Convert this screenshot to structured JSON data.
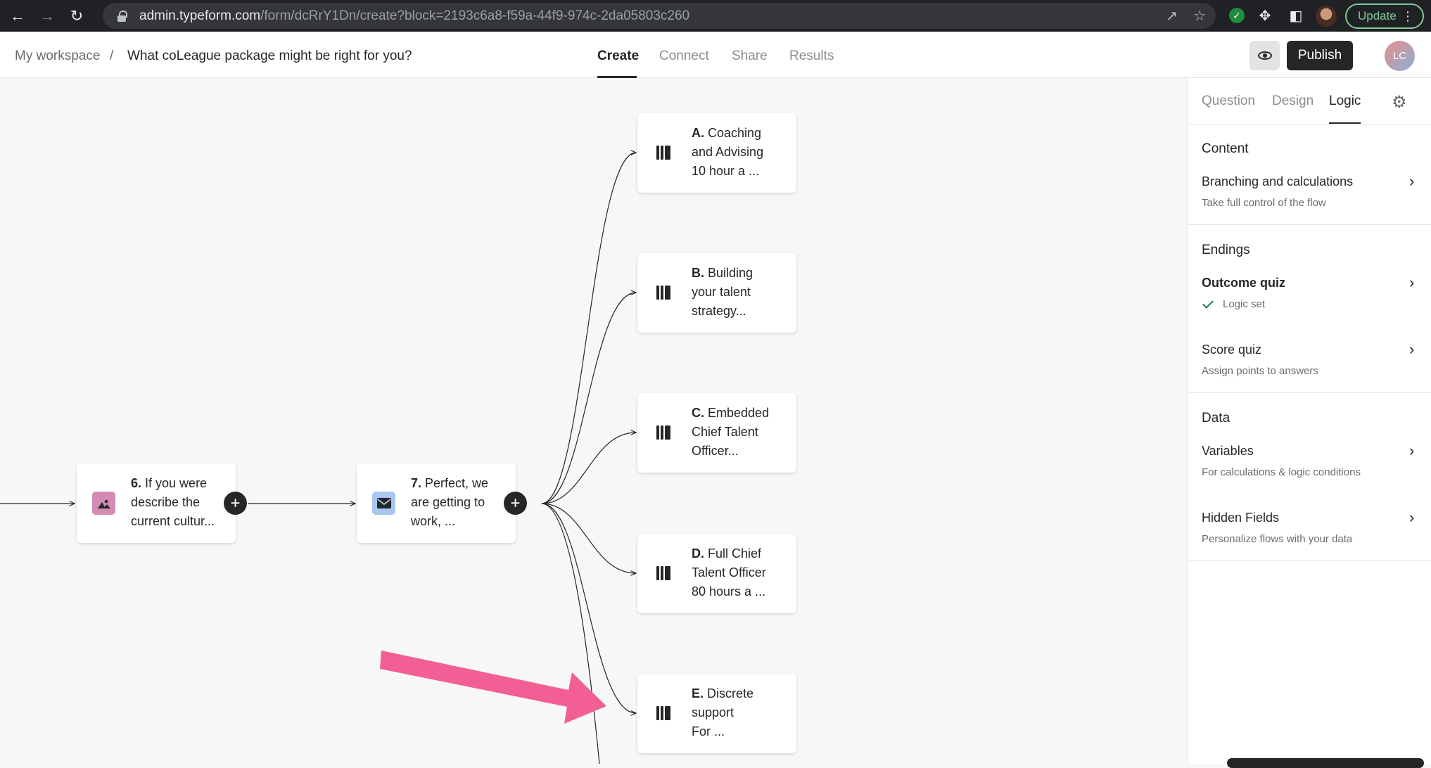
{
  "browser": {
    "url_host": "admin.typeform.com",
    "url_path": "/form/dcRrY1Dn/create?block=2193c6a8-f59a-44f9-974c-2da05803c260",
    "update_label": "Update"
  },
  "header": {
    "breadcrumb_workspace": "My workspace",
    "breadcrumb_separator": "/",
    "form_title": "What coLeague package might be right for you?",
    "tabs": [
      "Create",
      "Connect",
      "Share",
      "Results"
    ],
    "active_tab": "Create",
    "publish_label": "Publish",
    "avatar_initials": "LC"
  },
  "canvas": {
    "nodes": [
      {
        "num": "6.",
        "text": [
          "If you were",
          "describe the",
          "current cultur..."
        ],
        "icon": "image-icon",
        "icon_color": "#d48cb4"
      },
      {
        "num": "7.",
        "text": [
          "Perfect, we",
          "are getting to",
          "work, ..."
        ],
        "icon": "envelope-icon",
        "icon_color": "#a8c6f0"
      }
    ],
    "endings": [
      {
        "letter": "A.",
        "text": [
          "Coaching",
          "and Advising",
          "10 hour a ..."
        ]
      },
      {
        "letter": "B.",
        "text": [
          "Building",
          "your talent",
          "strategy..."
        ]
      },
      {
        "letter": "C.",
        "text": [
          "Embedded",
          "Chief Talent",
          "Officer..."
        ]
      },
      {
        "letter": "D.",
        "text": [
          "Full Chief",
          "Talent Officer",
          "80 hours a ..."
        ]
      },
      {
        "letter": "E.",
        "text": [
          "Discrete",
          "support",
          "For ..."
        ]
      }
    ],
    "annotation_color": "#f25f94"
  },
  "panel": {
    "tabs": [
      "Question",
      "Design",
      "Logic"
    ],
    "active_tab": "Logic",
    "content_title": "Content",
    "branching_title": "Branching and calculations",
    "branching_sub": "Take full control of the flow",
    "endings_title": "Endings",
    "outcome_title": "Outcome quiz",
    "outcome_status": "Logic set",
    "score_title": "Score quiz",
    "score_sub": "Assign points to answers",
    "data_title": "Data",
    "variables_title": "Variables",
    "variables_sub": "For calculations & logic conditions",
    "hidden_title": "Hidden Fields",
    "hidden_sub": "Personalize flows with your data"
  }
}
